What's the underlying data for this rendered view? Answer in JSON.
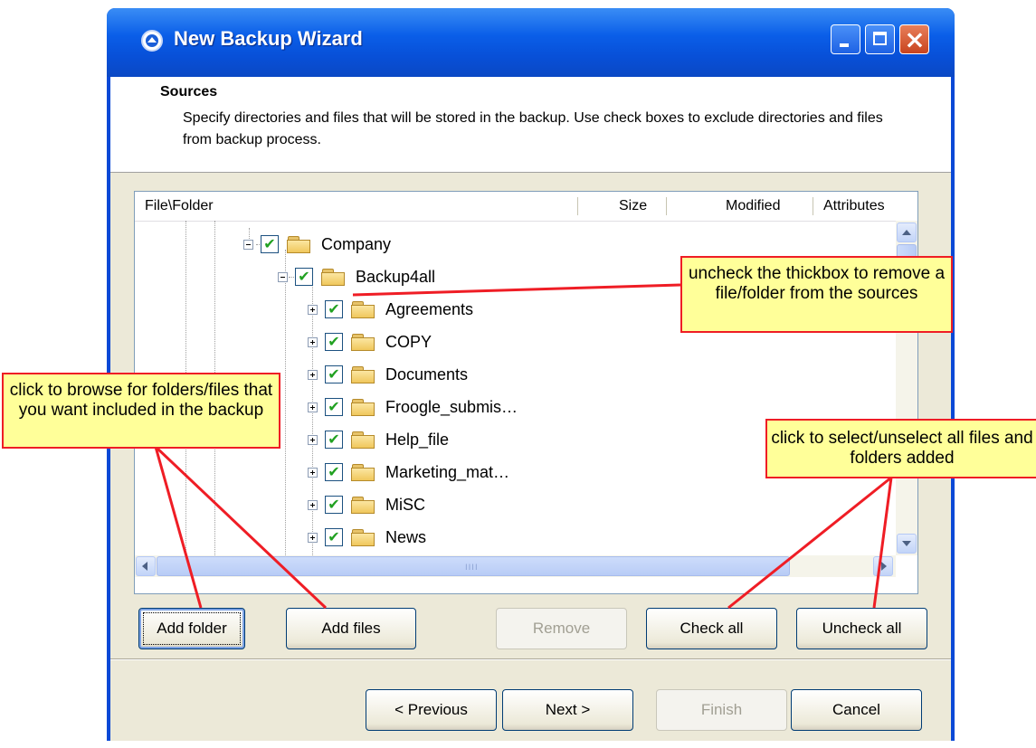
{
  "window": {
    "title": "New Backup Wizard"
  },
  "header": {
    "title": "Sources",
    "description": "Specify directories and files that will be stored in the backup. Use check boxes to exclude directories and files from backup process."
  },
  "tree": {
    "columns": [
      "File\\Folder",
      "Size",
      "Modified",
      "Attributes"
    ],
    "items": [
      {
        "label": "Company",
        "checked": true,
        "level": 0
      },
      {
        "label": "Backup4all",
        "checked": true,
        "level": 1
      },
      {
        "label": "Agreements",
        "checked": true,
        "level": 2
      },
      {
        "label": "COPY",
        "checked": true,
        "level": 2
      },
      {
        "label": "Documents",
        "checked": true,
        "level": 2
      },
      {
        "label": "Froogle_submis…",
        "checked": true,
        "level": 2
      },
      {
        "label": "Help_file",
        "checked": true,
        "level": 2
      },
      {
        "label": "Marketing_mat…",
        "checked": true,
        "level": 2
      },
      {
        "label": "MiSC",
        "checked": true,
        "level": 2
      },
      {
        "label": "News",
        "checked": true,
        "level": 2
      }
    ],
    "hscroll_grip": "IIII"
  },
  "buttons": {
    "add_folder": "Add folder",
    "add_files": "Add files",
    "remove": "Remove",
    "check_all": "Check all",
    "uncheck_all": "Uncheck all",
    "previous": "< Previous",
    "next": "Next >",
    "finish": "Finish",
    "cancel": "Cancel"
  },
  "callouts": {
    "uncheck": "uncheck the thickbox to remove a file/folder from the sources",
    "browse": "click to browse for folders/files that you want included in the backup",
    "select_all": "click to select/unselect all files and folders added"
  },
  "colors": {
    "titlebar": "#0a5ee8",
    "client": "#ece9d8",
    "callout_bg": "#ffff99",
    "callout_border": "#ef1d25",
    "check": "#21a121"
  }
}
